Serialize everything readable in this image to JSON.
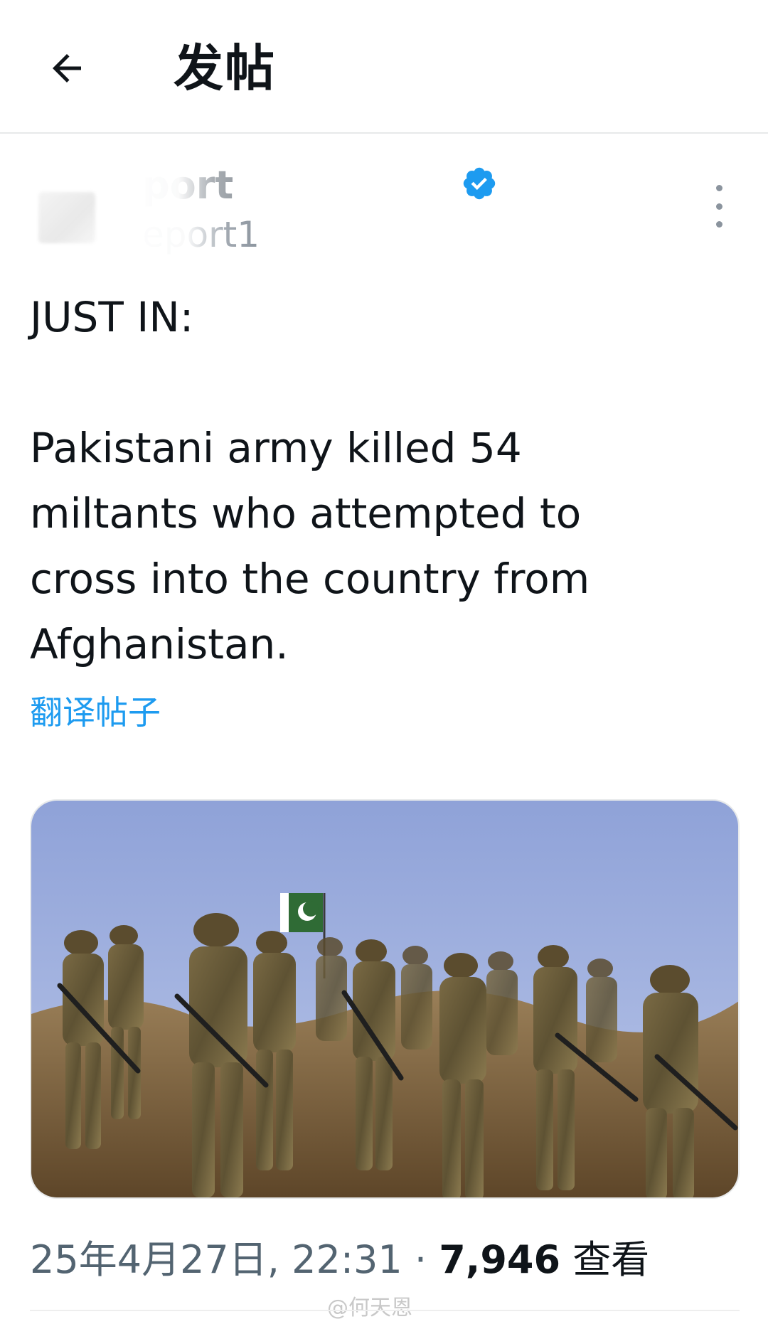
{
  "header": {
    "back_icon": "arrow-left-icon",
    "title": "发帖"
  },
  "author": {
    "display_name": "port",
    "handle": "eport1",
    "verified_icon": "verified-badge-icon",
    "more_icon": "more-vertical-icon",
    "verified_color": "#1d9bf0"
  },
  "post": {
    "text": "JUST IN:\n\nPakistani army killed 54\nmiltants who attempted to\ncross into the country from\nAfghanistan.",
    "translate_label": "翻译帖子",
    "image_description_icon": "soldiers-photo"
  },
  "meta": {
    "timestamp": "25年4月27日, 22:31",
    "separator": " · ",
    "views_count": "7,946",
    "views_label": "查看"
  },
  "watermark": {
    "text": "@何天恩"
  },
  "colors": {
    "link": "#1d9bf0",
    "text": "#0f1419",
    "muted": "#536471"
  }
}
